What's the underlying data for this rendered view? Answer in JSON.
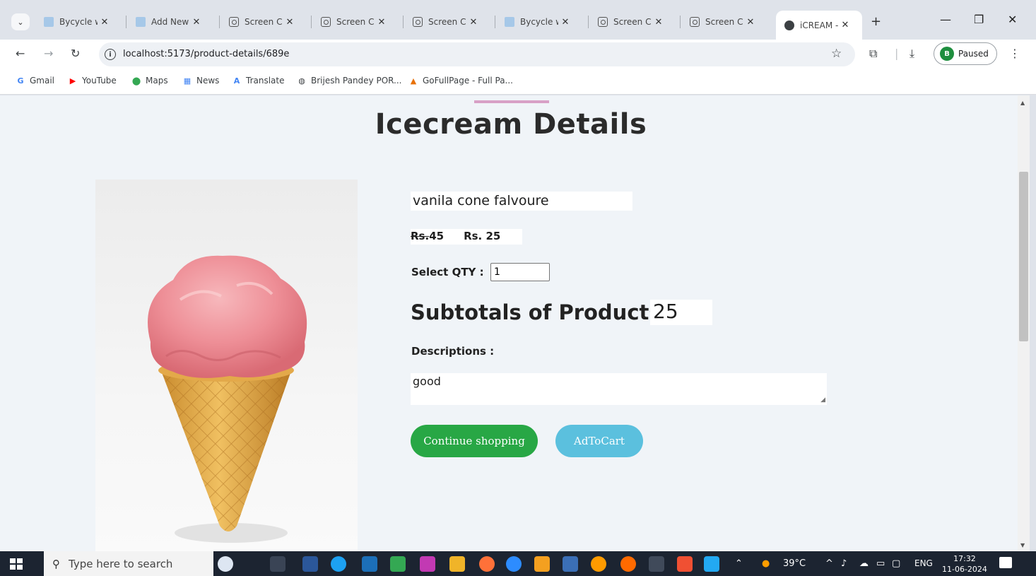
{
  "browser": {
    "tabs": [
      {
        "title": "Bycycle w",
        "icon": "doc-icon",
        "active": false
      },
      {
        "title": "Add New",
        "icon": "doc-icon",
        "active": false
      },
      {
        "title": "Screen Ca",
        "icon": "camera-icon",
        "active": false
      },
      {
        "title": "Screen Ca",
        "icon": "camera-icon",
        "active": false
      },
      {
        "title": "Screen Ca",
        "icon": "camera-icon",
        "active": false
      },
      {
        "title": "Bycycle w",
        "icon": "doc-icon",
        "active": false
      },
      {
        "title": "Screen Ca",
        "icon": "camera-icon",
        "active": false
      },
      {
        "title": "Screen Ca",
        "icon": "camera-icon",
        "active": false
      },
      {
        "title": "iCREAM -",
        "icon": "globe-icon",
        "active": true
      }
    ],
    "tab_close_glyph": "✕",
    "new_tab_glyph": "+",
    "url": "localhost:5173/product-details/689e",
    "profile_initial": "B",
    "profile_status": "Paused",
    "bookmarks": [
      {
        "label": "Gmail",
        "glyph": "G",
        "color": "#4285f4"
      },
      {
        "label": "YouTube",
        "glyph": "▶",
        "color": "#ff0000"
      },
      {
        "label": "Maps",
        "glyph": "⬤",
        "color": "#34a853"
      },
      {
        "label": "News",
        "glyph": "▦",
        "color": "#4285f4"
      },
      {
        "label": "Translate",
        "glyph": "A",
        "color": "#4285f4"
      },
      {
        "label": "Brijesh Pandey POR...",
        "glyph": "◍",
        "color": "#3c4043"
      },
      {
        "label": "GoFullPage - Full Pa...",
        "glyph": "▲",
        "color": "#e8710a"
      }
    ]
  },
  "page": {
    "title": "Icecream Details",
    "product_name": "vanila cone falvoure",
    "old_price_prefix": "Rs.",
    "old_price_value": "45",
    "new_price": "Rs. 25",
    "qty_label": "Select QTY :",
    "qty_value": "1",
    "subtotal_label": "Subtotals of Products :",
    "subtotal_value": "25",
    "descriptions_label": "Descriptions :",
    "description_text": "good",
    "continue_label": "Continue shopping",
    "cart_label": "AdToCart",
    "colors": {
      "continue_button": "#28a745",
      "cart_button": "#5bc0de",
      "accent_bar": "#d8a0c6"
    }
  },
  "taskbar": {
    "search_placeholder": "Type here to search",
    "weather": "39°C",
    "language": "ENG",
    "time": "17:32",
    "date": "11-06-2024"
  }
}
